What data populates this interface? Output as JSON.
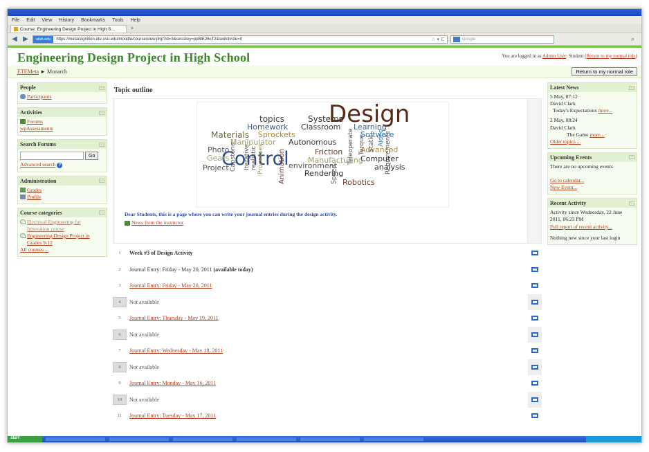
{
  "browser": {
    "menu": [
      "File",
      "Edit",
      "View",
      "History",
      "Bookmarks",
      "Tools",
      "Help"
    ],
    "tab_title": "Course: Engineering Design Project in High S...",
    "new_tab": "+",
    "identity_label": "utah.edu",
    "url": "https://metacognition.ete.usu.edu/moodle/course/view.php?id=3&sesskey=ppBlE26cT2&switchrole=0",
    "search_placeholder": "Google"
  },
  "header": {
    "site_title": "Engineering Design Project in High School",
    "logged_in_prefix": "You are logged in as ",
    "user_name": "Admin User",
    "logged_in_middle": ": Student (",
    "return_link": "Return to my normal role",
    "logged_in_suffix": ")"
  },
  "breadcrumb": {
    "home": "ETEMeta",
    "separator": "►",
    "current": "Monarch"
  },
  "return_button": "Return to my normal role",
  "left_blocks": {
    "people": {
      "title": "People",
      "participants": "Participants"
    },
    "activities": {
      "title": "Activities",
      "forums": "Forums",
      "wpassessments": "wpAssessments"
    },
    "search": {
      "title": "Search Forums",
      "go": "Go",
      "advanced": "Advanced search"
    },
    "admin": {
      "title": "Administration",
      "grades": "Grades",
      "profile": "Profile"
    },
    "categories": {
      "title": "Course categories",
      "cat1": "Electrical Engineering for Innovation course",
      "cat2": "Engineering Design Project in Grades 9-12",
      "all": "All courses ..."
    }
  },
  "main": {
    "topic_title": "Topic outline",
    "intro": "Dear Students, this is a page where you can write your journal entries during the design activity.",
    "news_link": "News from the instructor",
    "sections": [
      {
        "num": "1",
        "text": "Week #3 of Design Activity",
        "style": "bold",
        "boxed": false
      },
      {
        "num": "2",
        "text": "Journal Entry: Friday - May 20, 2011",
        "extra": " (available today)",
        "style": "plain",
        "boxed": false
      },
      {
        "num": "3",
        "text": "Journal Entry: Friday - May 20, 2011",
        "style": "link",
        "boxed": false
      },
      {
        "num": "4",
        "text": "Not available",
        "style": "gray",
        "boxed": true
      },
      {
        "num": "5",
        "text": "Journal Entry: Thursday - May 19, 2011",
        "style": "link",
        "boxed": false
      },
      {
        "num": "6",
        "text": "Not available",
        "style": "gray",
        "boxed": true
      },
      {
        "num": "7",
        "text": "Journal Entry: Wednesday - May 18, 2011",
        "style": "link",
        "boxed": false
      },
      {
        "num": "8",
        "text": "Not available",
        "style": "gray",
        "boxed": true
      },
      {
        "num": "9",
        "text": "Journal Entry: Monday - May 16, 2011",
        "style": "link",
        "boxed": false
      },
      {
        "num": "10",
        "text": "Not available",
        "style": "gray",
        "boxed": true
      },
      {
        "num": "11",
        "text": "Journal Entry: Tuesday - May 17, 2011",
        "style": "link",
        "boxed": false
      }
    ]
  },
  "wordcloud_words": [
    {
      "t": "Design",
      "s": 34,
      "c": "#5a2a1a"
    },
    {
      "t": "Control",
      "s": 27,
      "c": "#2a4a8a"
    },
    {
      "t": "topics",
      "s": 12,
      "c": "#444"
    },
    {
      "t": "Systems",
      "s": 12,
      "c": "#333"
    },
    {
      "t": "Homework",
      "s": 11,
      "c": "#3a5a8a"
    },
    {
      "t": "Classroom",
      "s": 11,
      "c": "#333"
    },
    {
      "t": "Learning",
      "s": 11,
      "c": "#3a5a8a"
    },
    {
      "t": "Materials",
      "s": 12,
      "c": "#6a6a4a"
    },
    {
      "t": "Sprockets",
      "s": 11,
      "c": "#b08a3a"
    },
    {
      "t": "Software",
      "s": 11,
      "c": "#3a7aa0"
    },
    {
      "t": "Manipulator",
      "s": 11,
      "c": "#a09a6a"
    },
    {
      "t": "Autonomous",
      "s": 11,
      "c": "#333"
    },
    {
      "t": "Photo",
      "s": 11,
      "c": "#555"
    },
    {
      "t": "Gears",
      "s": 11,
      "c": "#a0a07a"
    },
    {
      "t": "Friction",
      "s": 11,
      "c": "#6a3a2a"
    },
    {
      "t": "Advanced",
      "s": 11,
      "c": "#b08a3a"
    },
    {
      "t": "Manufacturing",
      "s": 11,
      "c": "#a09a6a"
    },
    {
      "t": "Computer",
      "s": 11,
      "c": "#333"
    },
    {
      "t": "Project",
      "s": 11,
      "c": "#555"
    },
    {
      "t": "environment",
      "s": 11,
      "c": "#555"
    },
    {
      "t": "analysis",
      "s": 11,
      "c": "#333"
    },
    {
      "t": "Rendering",
      "s": 11,
      "c": "#333"
    },
    {
      "t": "Robotics",
      "s": 11,
      "c": "#6a3a2a"
    },
    {
      "t": "Capstone",
      "s": 9,
      "c": "#555"
    },
    {
      "t": "Iterative",
      "s": 9,
      "c": "#555"
    },
    {
      "t": "realistic",
      "s": 9,
      "c": "#555"
    },
    {
      "t": "Processes",
      "s": 9,
      "c": "#a09a6a"
    },
    {
      "t": "Animation",
      "s": 10,
      "c": "#6a3a2a"
    },
    {
      "t": "Teleoperate",
      "s": 9,
      "c": "#555"
    },
    {
      "t": "Torque",
      "s": 9,
      "c": "#555"
    },
    {
      "t": "Static",
      "s": 9,
      "c": "#555"
    },
    {
      "t": "Aided",
      "s": 9,
      "c": "#3a7aa0"
    },
    {
      "t": "Requirements",
      "s": 9,
      "c": "#555"
    },
    {
      "t": "Speed",
      "s": 9,
      "c": "#555"
    }
  ],
  "right_blocks": {
    "news": {
      "title": "Latest News",
      "item1_date": "5 May, 07:12",
      "item1_author": "David Clark",
      "item1_text": "Today's Expectations",
      "item1_more": "more...",
      "item2_date": "2 May, 08:24",
      "item2_author": "David Clark",
      "item2_text": "The Game",
      "item2_more": "more...",
      "older": "Older topics ..."
    },
    "events": {
      "title": "Upcoming Events",
      "none": "There are no upcoming events",
      "calendar": "Go to calendar...",
      "new_event": "New Event..."
    },
    "recent": {
      "title": "Recent Activity",
      "since": "Activity since Wednesday, 22 June 2011, 06:23 PM",
      "report": "Full report of recent activity...",
      "nothing": "Nothing new since your last login"
    }
  },
  "taskbar": {
    "start": "start"
  },
  "colors": {
    "accent_green": "#3b8a2a",
    "link": "#b03d1e",
    "block_bg": "#eef7e2"
  }
}
